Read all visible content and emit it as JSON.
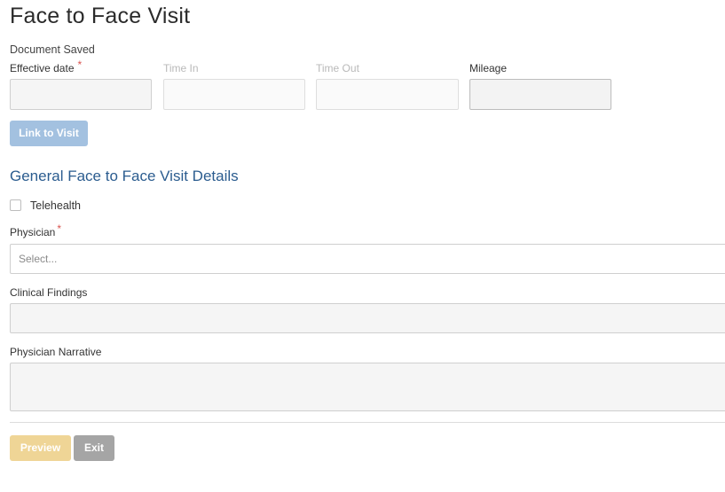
{
  "page": {
    "title": "Face to Face Visit",
    "status": "Document Saved"
  },
  "visit_fields": {
    "effective_date": {
      "label": "Effective date",
      "required_mark": "*",
      "value": ""
    },
    "time_in": {
      "label": "Time In",
      "value": ""
    },
    "time_out": {
      "label": "Time Out",
      "value": ""
    },
    "mileage": {
      "label": "Mileage",
      "value": ""
    }
  },
  "link_button": {
    "label": "Link to Visit"
  },
  "details_section": {
    "title": "General Face to Face Visit Details",
    "telehealth": {
      "label": "Telehealth",
      "checked": false
    },
    "physician": {
      "label": "Physician",
      "required_mark": "*",
      "placeholder": "Select..."
    },
    "clinical_findings": {
      "label": "Clinical Findings",
      "value": ""
    },
    "physician_narrative": {
      "label": "Physician Narrative",
      "value": ""
    }
  },
  "footer": {
    "preview_label": "Preview",
    "exit_label": "Exit"
  },
  "colors": {
    "section_title": "#2b5c8f",
    "required": "#d9534f",
    "link_button": "#a3c1e0",
    "preview_button": "#efd596",
    "exit_button": "#a5a5a5"
  }
}
